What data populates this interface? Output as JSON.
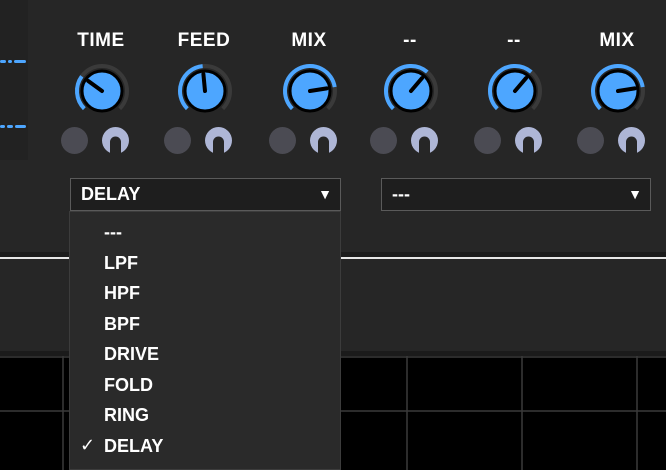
{
  "effect_slots": [
    {
      "knobs": [
        {
          "label": "TIME",
          "value": 0.3
        },
        {
          "label": "FEED",
          "value": 0.48
        },
        {
          "label": "MIX",
          "value": 0.8
        }
      ],
      "selected_effect": "DELAY"
    },
    {
      "knobs": [
        {
          "label": "--",
          "value": 0.65
        },
        {
          "label": "--",
          "value": 0.65
        },
        {
          "label": "MIX",
          "value": 0.8
        }
      ],
      "selected_effect": "---"
    }
  ],
  "dropdown": {
    "open": true,
    "options": [
      "---",
      "LPF",
      "HPF",
      "BPF",
      "DRIVE",
      "FOLD",
      "RING",
      "DELAY"
    ],
    "checked": "DELAY",
    "check_glyph": "✓"
  },
  "dropdown_arrow": "▼",
  "colors": {
    "accent": "#4da6ff",
    "knob_track": "#3a3a3a",
    "knob_arc": "#4da6ff",
    "toggle_ring": "#aeb6d6",
    "panel": "#262626",
    "divider": "#e6e6e6"
  },
  "icons": {
    "waveform": "waveform-icon",
    "toggle_off": "circle-dot-icon",
    "toggle_ring": "ring-toggle-icon",
    "dropdown_arrow": "triangle-down-icon",
    "check": "check-icon"
  }
}
